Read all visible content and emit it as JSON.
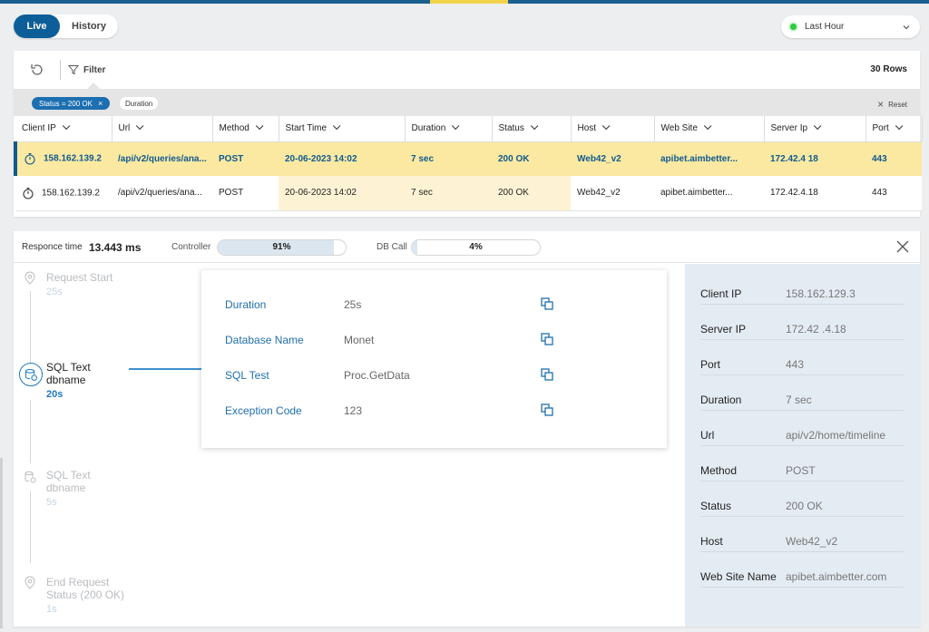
{
  "tabs": {
    "live": "Live",
    "history": "History"
  },
  "time_range": {
    "label": "Last Hour",
    "status_color": "#2ecc40"
  },
  "toolbar": {
    "filter_label": "Filter",
    "rows_count": "30 Rows"
  },
  "chips": {
    "status": "Status = 200 OK",
    "status_remove": "×",
    "duration": "Duration",
    "reset": "Reset",
    "reset_icon": "×"
  },
  "table": {
    "columns": [
      "Client IP",
      "Url",
      "Method",
      "Start Time",
      "Duration",
      "Status",
      "Host",
      "Web Site",
      "Server Ip",
      "Port"
    ],
    "rows": [
      {
        "client_ip": "158.162.139.2",
        "url": "/api/v2/queries/ana...",
        "method": "POST",
        "start_time": "20-06-2023 14:02",
        "duration": "7 sec",
        "status": "200 OK",
        "host": "Web42_v2",
        "web_site": "apibet.aimbetter...",
        "server_ip": "172.42.4 18",
        "port": "443"
      },
      {
        "client_ip": "158.162.139.2",
        "url": "/api/v2/queries/ana...",
        "method": "POST",
        "start_time": "20-06-2023 14:02",
        "duration": "7 sec",
        "status": "200 OK",
        "host": "Web42_v2",
        "web_site": "apibet.aimbetter...",
        "server_ip": "172.42.4.18",
        "port": "443"
      }
    ]
  },
  "detail": {
    "response_time_label": "Responce time",
    "response_time_value": "13.443 ms",
    "controller_label": "Controller",
    "controller_value": "91%",
    "controller_pct": 91,
    "dbcall_label": "DB Call",
    "dbcall_value": "4%",
    "dbcall_pct": 4
  },
  "timeline": [
    {
      "title": "Request Start",
      "time": "25s"
    },
    {
      "title": "SQL Text",
      "subtitle": "dbname",
      "time": "20s"
    },
    {
      "title": "SQL Text",
      "subtitle": "dbname",
      "time": "5s"
    },
    {
      "title": "End Request",
      "subtitle": "Status (200 OK)",
      "time": "1s"
    }
  ],
  "card": [
    {
      "key": "Duration",
      "value": "25s"
    },
    {
      "key": "Database Name",
      "value": "Monet"
    },
    {
      "key": "SQL Test",
      "value": "Proc.GetData"
    },
    {
      "key": "Exception Code",
      "value": "123"
    }
  ],
  "side": [
    {
      "key": "Client IP",
      "value": "158.162.129.3"
    },
    {
      "key": "Server IP",
      "value": "172.42 .4.18"
    },
    {
      "key": "Port",
      "value": "443"
    },
    {
      "key": "Duration",
      "value": "7 sec"
    },
    {
      "key": "Url",
      "value": "api/v2/home/timeline"
    },
    {
      "key": "Method",
      "value": "POST"
    },
    {
      "key": "Status",
      "value": "200 OK"
    },
    {
      "key": "Host",
      "value": "Web42_v2"
    },
    {
      "key": "Web Site Name",
      "value": "apibet.aimbetter.com"
    }
  ],
  "colors": {
    "primary": "#0d5d98",
    "highlight": "#fbe9a2",
    "link": "#1f6fab",
    "side_bg": "#e4ecf3"
  }
}
